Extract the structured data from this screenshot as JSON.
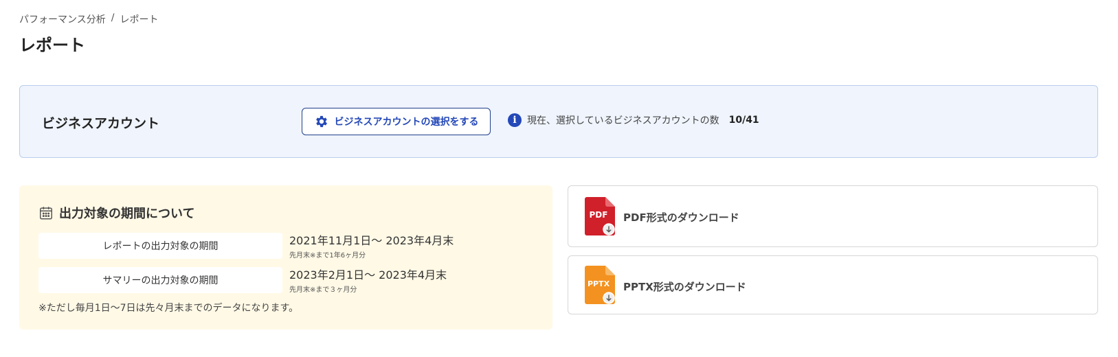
{
  "breadcrumb": {
    "parent": "パフォーマンス分析",
    "separator": "/",
    "current": "レポート"
  },
  "page": {
    "title": "レポート"
  },
  "account": {
    "label": "ビジネスアカウント",
    "select_button": "ビジネスアカウントの選択をする",
    "info_text": "現在、選択しているビジネスアカウントの数",
    "count": "10/41"
  },
  "period": {
    "heading": "出力対象の期間について",
    "rows": [
      {
        "label": "レポートの出力対象の期間",
        "value": "2021年11月1日〜 2023年4月末",
        "sub": "先月末※まで1年6ヶ月分"
      },
      {
        "label": "サマリーの出力対象の期間",
        "value": "2023年2月1日〜 2023年4月末",
        "sub": "先月末※まで３ヶ月分"
      }
    ],
    "note": "※ただし毎月1日〜7日は先々月末までのデータになります。"
  },
  "downloads": {
    "pdf": {
      "badge": "PDF",
      "label": "PDF形式のダウンロード",
      "color": "#d0202a"
    },
    "pptx": {
      "badge": "PPTX",
      "label": "PPTX形式のダウンロード",
      "color": "#f39220"
    }
  },
  "colors": {
    "accent": "#2448b8",
    "panel_blue": "#eff4fd",
    "panel_yellow": "#fff9e6"
  }
}
